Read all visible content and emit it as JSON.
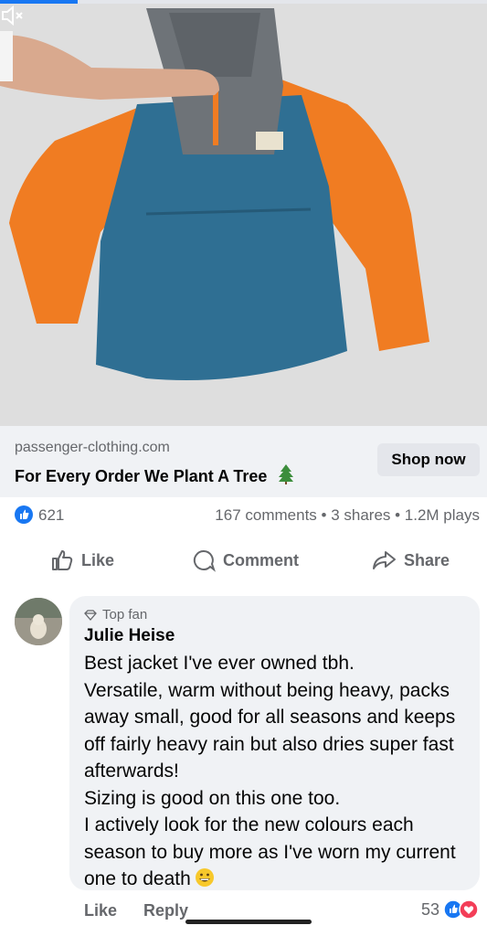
{
  "video": {
    "progress": 0.16
  },
  "ad": {
    "domain": "passenger-clothing.com",
    "headline": "For Every Order We Plant A Tree",
    "cta_label": "Shop now"
  },
  "stats": {
    "reactions": "621",
    "summary": "167 comments • 3 shares • 1.2M plays"
  },
  "actions": {
    "like": "Like",
    "comment": "Comment",
    "share": "Share"
  },
  "comment": {
    "badge": "Top fan",
    "author": "Julie Heise",
    "text": "Best jacket I've ever owned tbh.\nVersatile, warm without being heavy, packs away small, good for all seasons and keeps off fairly heavy rain but also dries super fast afterwards!\nSizing is good on this one too.\nI actively look for the new colours each season to buy more as I've worn my current one to death",
    "like_label": "Like",
    "reply_label": "Reply",
    "reaction_count": "53"
  },
  "colors": {
    "accent": "#1877f2",
    "love": "#f33e58",
    "jacket_orange": "#f07c22",
    "jacket_blue": "#2f6f93"
  }
}
